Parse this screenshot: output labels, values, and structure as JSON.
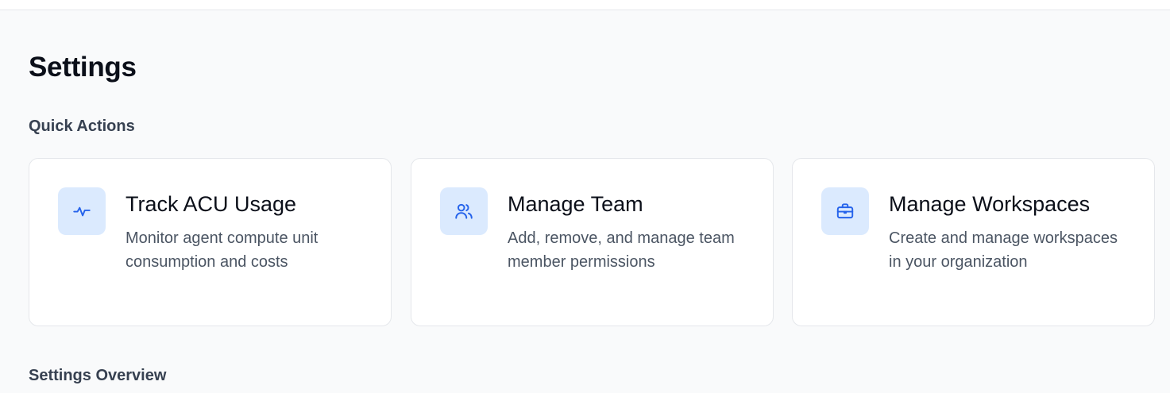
{
  "page": {
    "title": "Settings"
  },
  "quick_actions": {
    "heading": "Quick Actions",
    "cards": [
      {
        "icon": "activity-icon",
        "title": "Track ACU Usage",
        "description": "Monitor agent compute unit consumption and costs"
      },
      {
        "icon": "users-icon",
        "title": "Manage Team",
        "description": "Add, remove, and manage team member permissions"
      },
      {
        "icon": "briefcase-icon",
        "title": "Manage Workspaces",
        "description": "Create and manage workspaces in your organization"
      }
    ]
  },
  "overview": {
    "heading": "Settings Overview"
  },
  "colors": {
    "accent": "#2563eb",
    "icon_bg": "#dbeafe",
    "background": "#f9fafb",
    "card_border": "#e5e7eb"
  }
}
